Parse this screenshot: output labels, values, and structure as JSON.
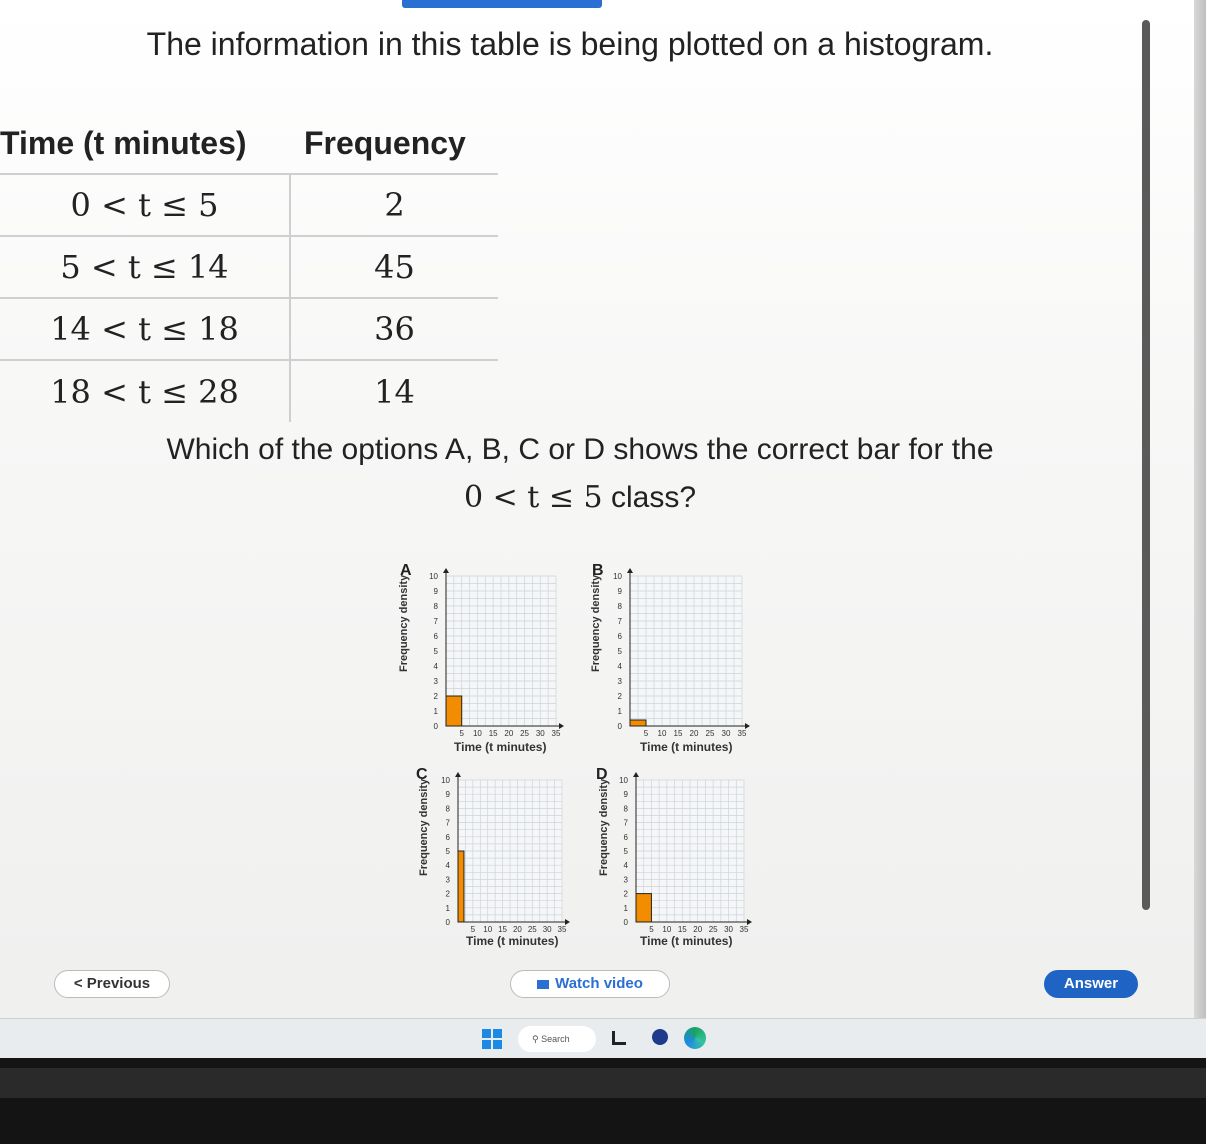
{
  "question": "The information in this table is being plotted on a histogram.",
  "table": {
    "headers": [
      "Time (t minutes)",
      "Frequency"
    ],
    "rows": [
      {
        "interval": "0 < t ≤ 5",
        "frequency": "2"
      },
      {
        "interval": "5 < t ≤ 14",
        "frequency": "45"
      },
      {
        "interval": "14 < t ≤ 18",
        "frequency": "36"
      },
      {
        "interval": "18 < t ≤ 28",
        "frequency": "14"
      }
    ]
  },
  "sub_question": {
    "line1": "Which of the options A, B, C or D shows the correct bar for the",
    "math": "0 < t ≤ 5",
    "line2_suffix": " class?"
  },
  "options_shared": {
    "ylabel": "Frequency density",
    "xlabel": "Time (t minutes)",
    "y_ticks": [
      "0",
      "1",
      "2",
      "3",
      "4",
      "5",
      "6",
      "7",
      "8",
      "9",
      "10"
    ],
    "x_ticks": [
      "5",
      "10",
      "15",
      "20",
      "25",
      "30",
      "35"
    ]
  },
  "chart_data": [
    {
      "type": "bar",
      "option": "A",
      "x_range": [
        0,
        5
      ],
      "bar_height": 2,
      "xlim": [
        0,
        35
      ],
      "ylim": [
        0,
        10
      ],
      "grid": true
    },
    {
      "type": "bar",
      "option": "B",
      "x_range": [
        0,
        5
      ],
      "bar_height": 0.4,
      "xlim": [
        0,
        35
      ],
      "ylim": [
        0,
        10
      ],
      "grid": true
    },
    {
      "type": "bar",
      "option": "C",
      "x_range": [
        0,
        2
      ],
      "bar_height": 5,
      "xlim": [
        0,
        35
      ],
      "ylim": [
        0,
        10
      ],
      "grid": true
    },
    {
      "type": "bar",
      "option": "D",
      "x_range": [
        0,
        5
      ],
      "bar_height": 2,
      "xlim": [
        0,
        35
      ],
      "ylim": [
        0,
        10
      ],
      "grid": true
    }
  ],
  "colors": {
    "bar_fill": "#f28c00",
    "bar_edge": "#222222",
    "grid": "#cfd3d8",
    "primary": "#1f64c4"
  },
  "buttons": {
    "previous": "< Previous",
    "watch_video": "Watch video",
    "answer": "Answer"
  },
  "taskbar": {
    "search": "Search"
  }
}
